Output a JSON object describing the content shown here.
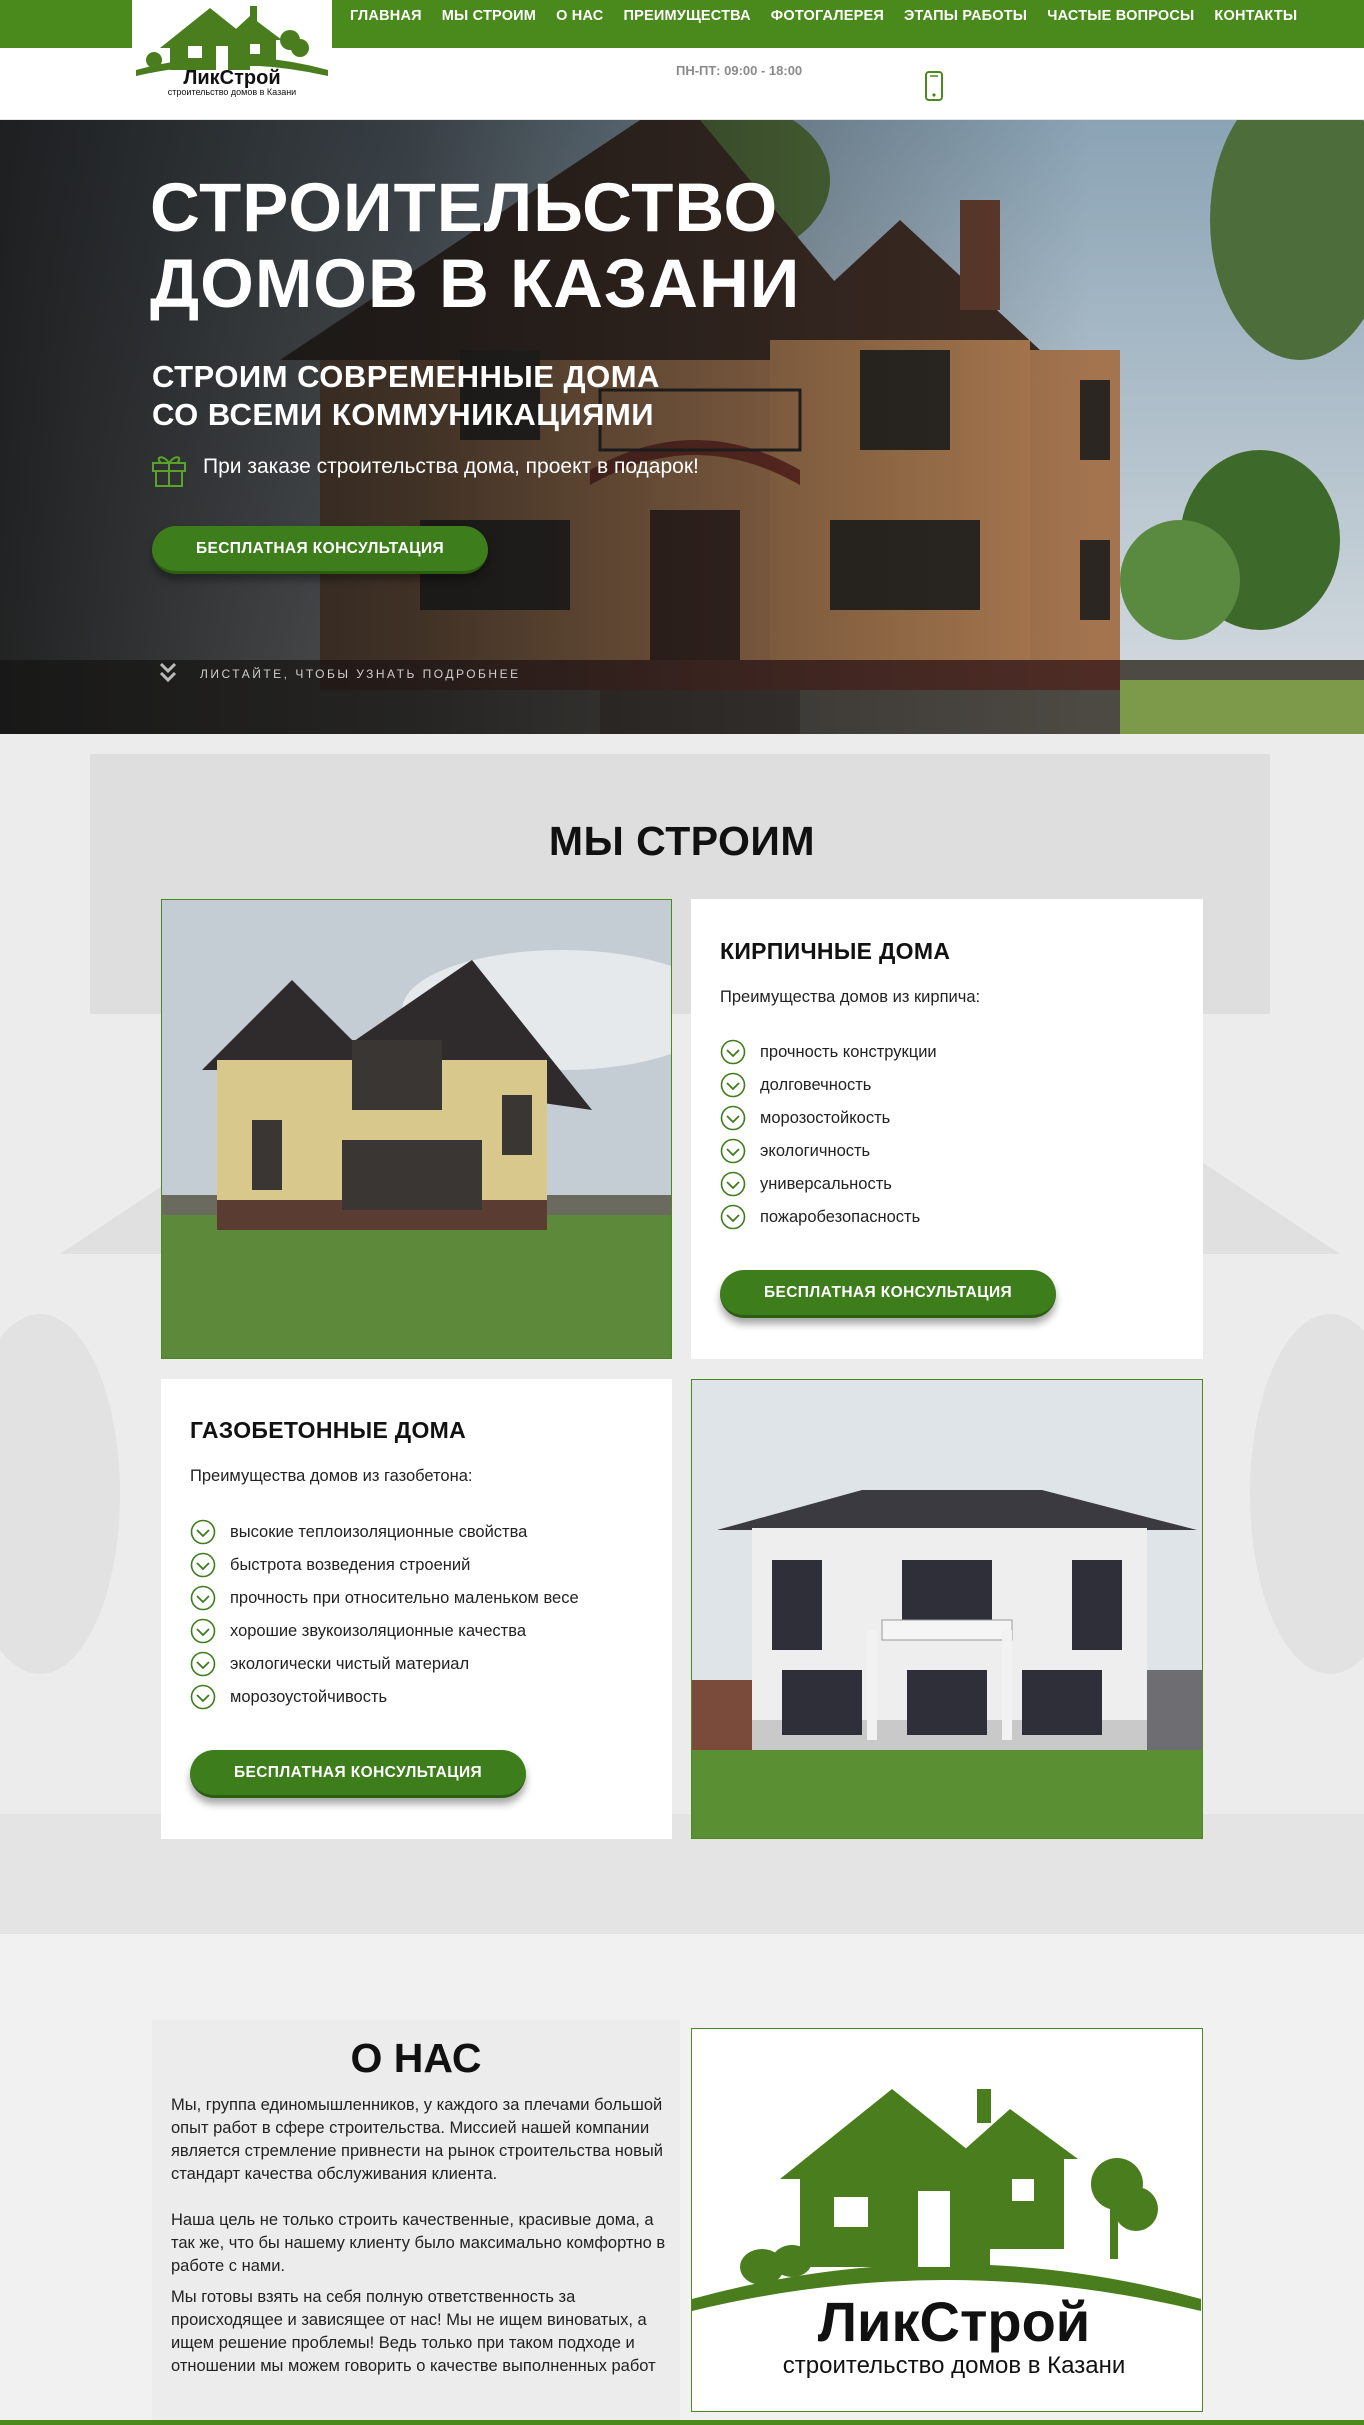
{
  "brand": {
    "name": "ЛикСтрой",
    "tagline": "строительство домов в Казани",
    "color": "#4a8a1c"
  },
  "nav": [
    "ГЛАВНАЯ",
    "МЫ СТРОИМ",
    "О НАС",
    "ПРЕИМУЩЕСТВА",
    "ФОТОГАЛЕРЕЯ",
    "ЭТАПЫ РАБОТЫ",
    "ЧАСТЫЕ ВОПРОСЫ",
    "КОНТАКТЫ"
  ],
  "header": {
    "hours": "ПН-ПТ: 09:00 - 18:00",
    "phone_icon": "smartphone-icon"
  },
  "hero": {
    "title_line1": "СТРОИТЕЛЬСТВО",
    "title_line2": "ДОМОВ В КАЗАНИ",
    "subtitle_line1": "СТРОИМ СОВРЕМЕННЫЕ ДОМА",
    "subtitle_line2": "СО ВСЕМИ КОММУНИКАЦИЯМИ",
    "gift_text": "При заказе строительства дома, проект в подарок!",
    "cta": "БЕСПЛАТНАЯ КОНСУЛЬТАЦИЯ",
    "scroll_hint": "ЛИСТАЙТЕ, ЧТОБЫ УЗНАТЬ ПОДРОБНЕЕ"
  },
  "we_build": {
    "title": "МЫ СТРОИМ",
    "brick": {
      "title": "КИРПИЧНЫЕ ДОМА",
      "lead": "Преимущества домов из кирпича:",
      "features": [
        "прочность конструкции",
        "долговечность",
        "морозостойкость",
        "экологичность",
        "универсальность",
        "пожаробезопасность"
      ],
      "cta": "БЕСПЛАТНАЯ КОНСУЛЬТАЦИЯ"
    },
    "gas": {
      "title": "ГАЗОБЕТОННЫЕ ДОМА",
      "lead": "Преимущества домов из газобетона:",
      "features": [
        "высокие теплоизоляционные свойства",
        "быстрота возведения строений",
        "прочность при относительно маленьком весе",
        "хорошие звукоизоляционные качества",
        "экологически чистый материал",
        "морозоустойчивость"
      ],
      "cta": "БЕСПЛАТНАЯ КОНСУЛЬТАЦИЯ"
    }
  },
  "about": {
    "title": "О НАС",
    "p1": "Мы, группа единомышленников, у каждого за плечами большой опыт работ в сфере строительства. Миссией нашей компании является стремление привнести на рынок строительства новый стандарт качества обслуживания клиента.",
    "p2": "Наша цель не только строить качественные, красивые дома, а так же, что бы нашему клиенту было максимально комфортно в работе с нами.",
    "p3": "Мы готовы взять на себя полную ответственность за происходящее и зависящее от нас! Мы не ищем виноватых, а ищем решение проблемы! Ведь только при таком подходе и отношении мы можем говорить о качестве выполненных работ"
  }
}
